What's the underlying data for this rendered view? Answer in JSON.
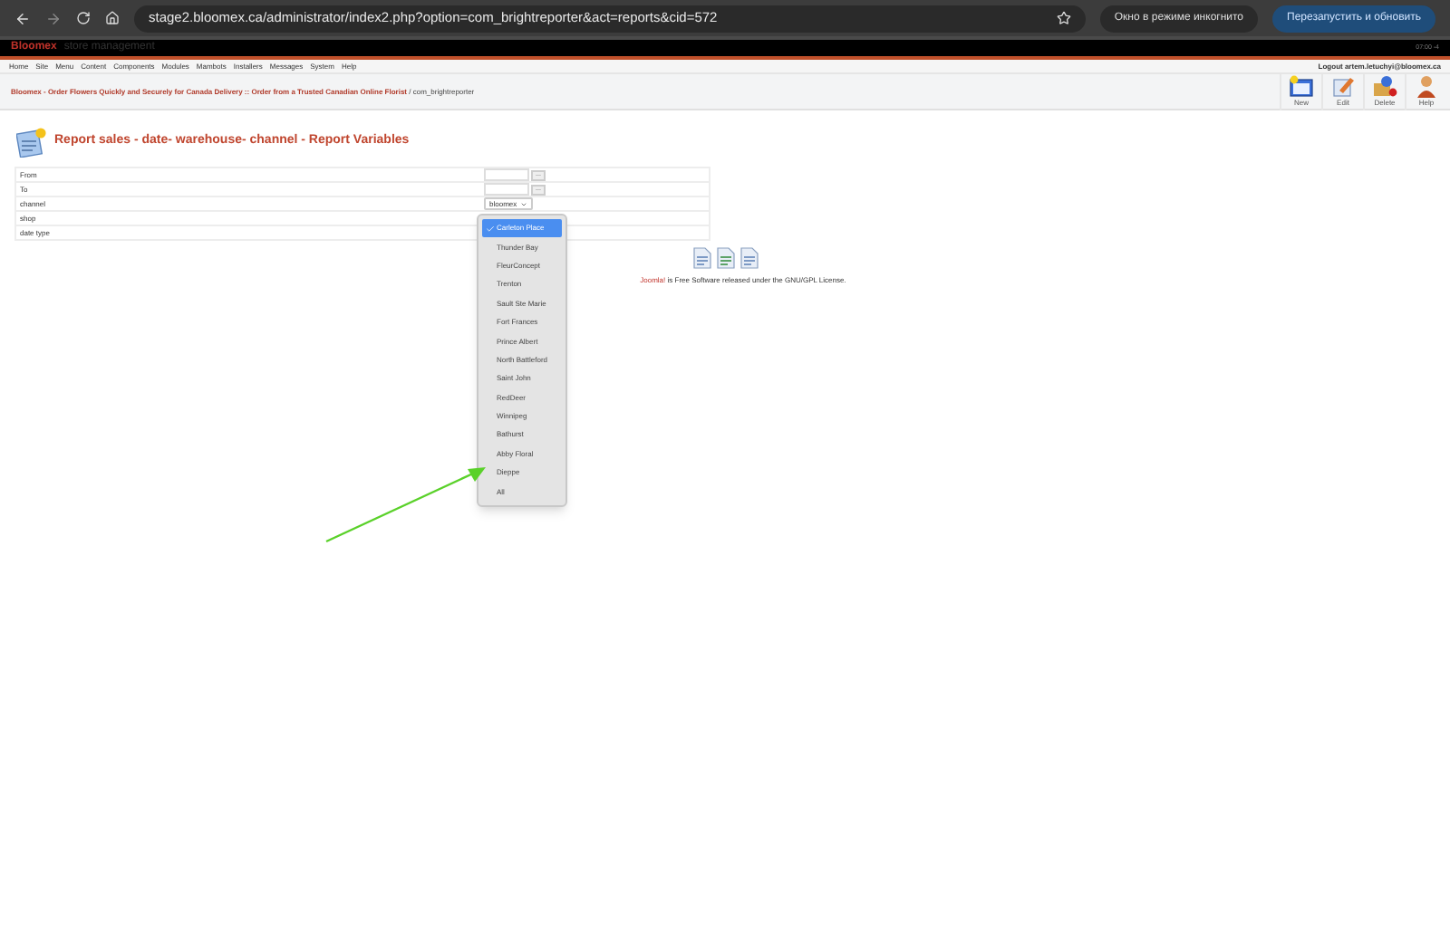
{
  "browser": {
    "url": "stage2.bloomex.ca/administrator/index2.php?option=com_brightreporter&act=reports&cid=572",
    "incognito": "Окно в режиме инкогнито",
    "update_button": "Перезапустить и обновить"
  },
  "header": {
    "brand": "Bloomex",
    "subtitle": "store management",
    "time": "07:00 -4"
  },
  "menu": [
    "Home",
    "Site",
    "Menu",
    "Content",
    "Components",
    "Modules",
    "Mambots",
    "Installers",
    "Messages",
    "System",
    "Help"
  ],
  "user": "Logout artem.letuchyi@bloomex.ca",
  "breadcrumb": {
    "link": "Bloomex - Order Flowers Quickly and Securely for Canada Delivery :: Order from a Trusted Canadian Online Florist",
    "rest": " / com_brightreporter"
  },
  "toolbar": [
    {
      "label": "New",
      "kind": "new"
    },
    {
      "label": "Edit",
      "kind": "edit"
    },
    {
      "label": "Delete",
      "kind": "delete"
    },
    {
      "label": "Help",
      "kind": "help"
    }
  ],
  "title": "Report sales - date- warehouse- channel - Report Variables",
  "fields": [
    {
      "label": "From",
      "kind": "date",
      "button": "..."
    },
    {
      "label": "To",
      "kind": "date",
      "button": "..."
    },
    {
      "label": "channel",
      "kind": "select",
      "value": "bloomex"
    },
    {
      "label": "shop",
      "kind": "empty"
    },
    {
      "label": "date type",
      "kind": "empty"
    }
  ],
  "dropdown": [
    {
      "label": "Carleton Place",
      "selected": true
    },
    {
      "label": "Thunder Bay",
      "selected": false
    },
    {
      "label": "FleurConcept",
      "selected": false
    },
    {
      "label": "Trenton",
      "selected": false
    },
    {
      "label": "Sault Ste Marie",
      "selected": false
    },
    {
      "label": "Fort Frances",
      "selected": false
    },
    {
      "label": "Prince Albert",
      "selected": false
    },
    {
      "label": "North Battleford",
      "selected": false
    },
    {
      "label": "Saint John",
      "selected": false
    },
    {
      "label": "RedDeer",
      "selected": false
    },
    {
      "label": "Winnipeg",
      "selected": false
    },
    {
      "label": "Bathurst",
      "selected": false
    },
    {
      "label": "Abby Floral",
      "selected": false
    },
    {
      "label": "Dieppe",
      "selected": false
    },
    {
      "label": "All",
      "selected": false
    }
  ],
  "footer": {
    "link": "Joomla!",
    "rest": " is Free Software released under the GNU/GPL License."
  }
}
